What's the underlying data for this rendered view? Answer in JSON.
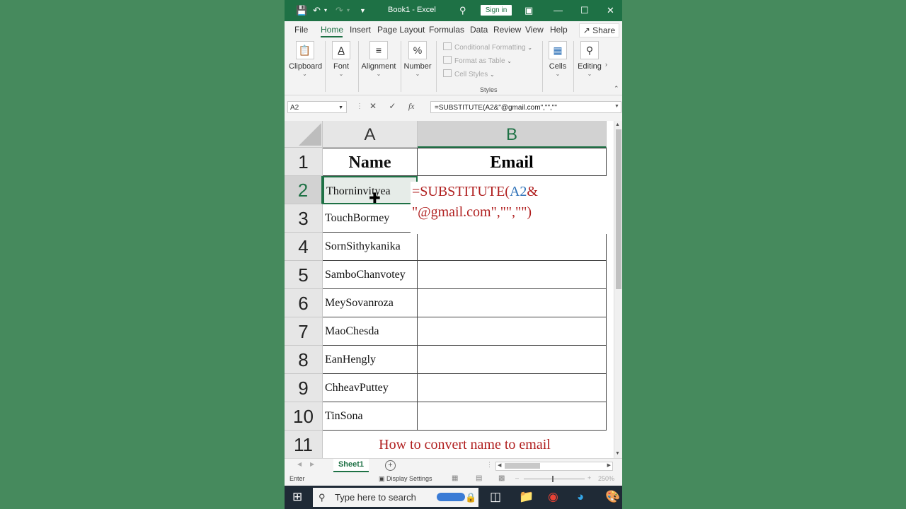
{
  "window": {
    "title": "Book1  -  Excel",
    "sign_in": "Sign in"
  },
  "tabs": [
    "File",
    "Home",
    "Insert",
    "Page Layout",
    "Formulas",
    "Data",
    "Review",
    "View",
    "Help"
  ],
  "share_label": "Share",
  "ribbon": {
    "clipboard": "Clipboard",
    "font": "Font",
    "alignment": "Alignment",
    "number": "Number",
    "conditional_formatting": "Conditional Formatting",
    "format_as_table": "Format as Table",
    "cell_styles": "Cell Styles",
    "styles": "Styles",
    "cells": "Cells",
    "editing": "Editing"
  },
  "formula_bar": {
    "name_box": "A2",
    "formula": "=SUBSTITUTE(A2&\"@gmail.com\",\"\",\"\""
  },
  "columns": [
    "A",
    "B"
  ],
  "rows": [
    "1",
    "2",
    "3",
    "4",
    "5",
    "6",
    "7",
    "8",
    "9",
    "10",
    "11"
  ],
  "header": {
    "a": "Name",
    "b": "Email"
  },
  "names": [
    "Thorninvit",
    "yea",
    "TouchBormey",
    "SornSithykanika",
    "SamboChanvotey",
    "MeySovanroza",
    "MaoChesda",
    "EanHengly",
    "ChheavPuttey",
    "TinSona"
  ],
  "edit_formula": {
    "line1_fn": "=SUBSTITUTE(",
    "line1_ref": "A2",
    "line1_amp": "&",
    "line2": "\"@gmail.com\",\"\",\"\")"
  },
  "footer_note": "How to convert name to email",
  "sheet_tab": "Sheet1",
  "status": {
    "mode": "Enter",
    "display_settings": "Display Settings",
    "zoom": "250%"
  },
  "taskbar": {
    "search_placeholder": "Type here to search"
  },
  "colors": {
    "excel_green": "#1e7145",
    "formula_red": "#b01f1f",
    "ref_blue": "#2f72b8",
    "background_green": "#468a5d"
  }
}
